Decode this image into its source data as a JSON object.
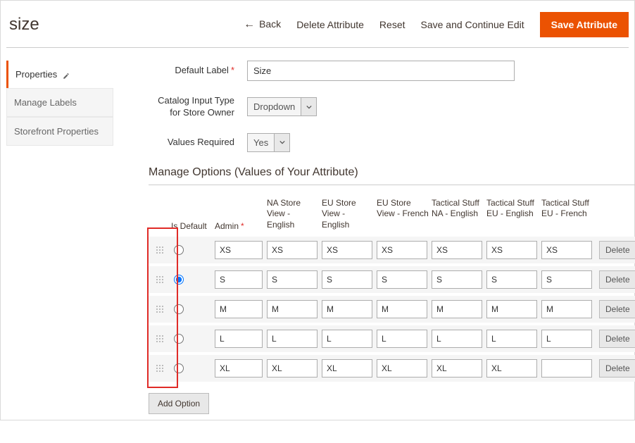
{
  "page": {
    "title": "size"
  },
  "toolbar": {
    "back": "Back",
    "delete": "Delete Attribute",
    "reset": "Reset",
    "save_continue": "Save and Continue Edit",
    "save": "Save Attribute"
  },
  "sidebar": {
    "items": [
      {
        "label": "Properties",
        "active": true
      },
      {
        "label": "Manage Labels",
        "active": false
      },
      {
        "label": "Storefront Properties",
        "active": false
      }
    ]
  },
  "form": {
    "default_label": {
      "label": "Default Label",
      "value": "Size"
    },
    "input_type": {
      "label": "Catalog Input Type for Store Owner",
      "value": "Dropdown"
    },
    "values_required": {
      "label": "Values Required",
      "value": "Yes"
    }
  },
  "manage_options": {
    "title": "Manage Options (Values of Your Attribute)",
    "add_option": "Add Option",
    "headers": {
      "is_default": "Is Default",
      "admin": "Admin",
      "stores": [
        "NA Store View - English",
        "EU Store View - English",
        "EU Store View - French",
        "Tactical Stuff NA - English",
        "Tactical Stuff EU - English",
        "Tactical Stuff EU - French"
      ]
    },
    "delete_label": "Delete",
    "rows": [
      {
        "is_default": false,
        "admin": "XS",
        "stores": [
          "XS",
          "XS",
          "XS",
          "XS",
          "XS",
          "XS"
        ]
      },
      {
        "is_default": true,
        "admin": "S",
        "stores": [
          "S",
          "S",
          "S",
          "S",
          "S",
          "S"
        ]
      },
      {
        "is_default": false,
        "admin": "M",
        "stores": [
          "M",
          "M",
          "M",
          "M",
          "M",
          "M"
        ]
      },
      {
        "is_default": false,
        "admin": "L",
        "stores": [
          "L",
          "L",
          "L",
          "L",
          "L",
          "L"
        ]
      },
      {
        "is_default": false,
        "admin": "XL",
        "stores": [
          "XL",
          "XL",
          "XL",
          "XL",
          "XL",
          ""
        ]
      }
    ]
  }
}
